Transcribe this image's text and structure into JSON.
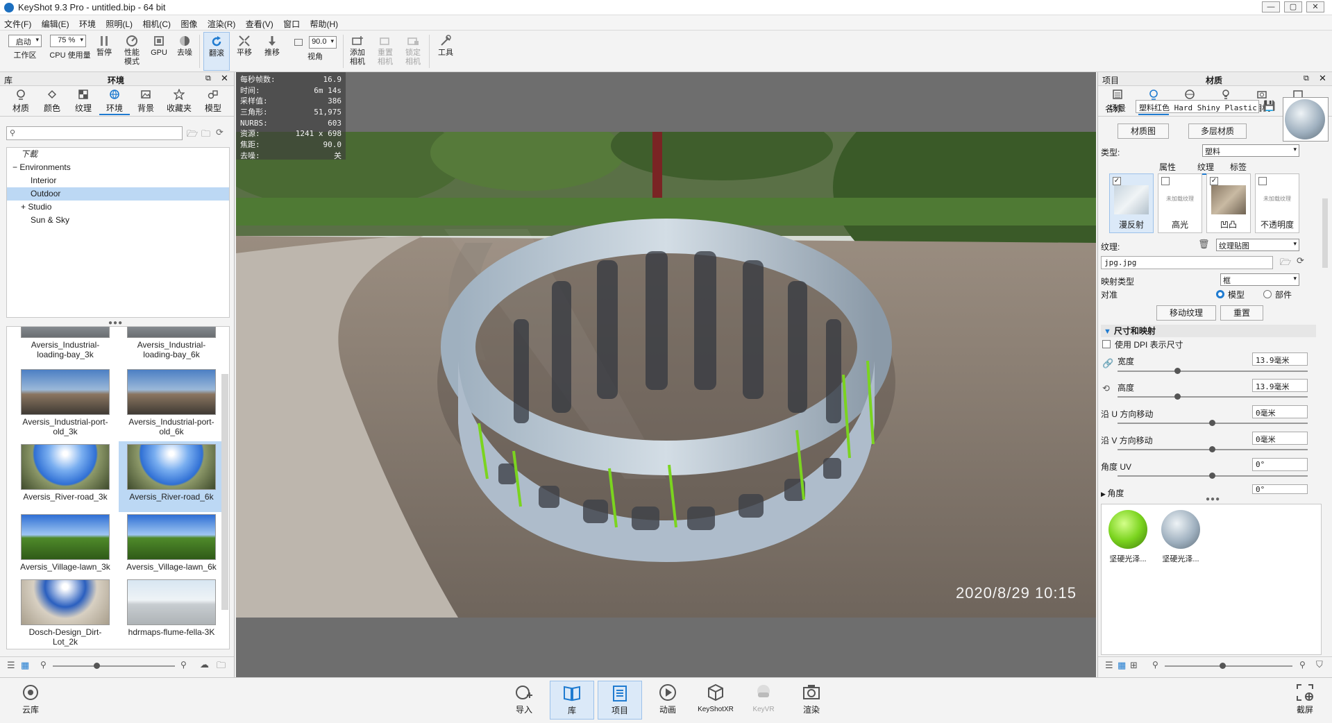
{
  "window": {
    "title": "KeyShot 9.3 Pro  - untitled.bip  - 64 bit",
    "controls": [
      "—",
      "▢",
      "✕"
    ]
  },
  "menu": [
    "文件(F)",
    "编辑(E)",
    "环境",
    "照明(L)",
    "相机(C)",
    "图像",
    "渲染(R)",
    "查看(V)",
    "窗口",
    "帮助(H)"
  ],
  "toolbar": {
    "workspace_value": "启动",
    "workspace_label": "工作区",
    "cpu_value": "75 %",
    "cpu_label": "CPU 使用量",
    "pause": "暂停",
    "perf_line1": "性能",
    "perf_line2": "模式",
    "gpu": "GPU",
    "denoise": "去噪",
    "tumble": "翻滚",
    "pan": "平移",
    "dolly": "推移",
    "fov_value": "90.0",
    "fov_label": "视角",
    "add_cam_1": "添加",
    "add_cam_2": "相机",
    "reset_cam_1": "重置",
    "reset_cam_2": "相机",
    "lock_cam_1": "锁定",
    "lock_cam_2": "相机",
    "tools": "工具"
  },
  "library": {
    "header_left": "库",
    "header_title": "环境",
    "tabs": [
      "材质",
      "颜色",
      "纹理",
      "环境",
      "背景",
      "收藏夹",
      "模型"
    ],
    "tree": {
      "download": "下載",
      "environments": "Environments",
      "interior": "Interior",
      "outdoor": "Outdoor",
      "studio": "Studio",
      "sunsky": "Sun & Sky"
    },
    "thumbs": [
      {
        "n1": "Aversis_Industrial-",
        "n2": "loading-bay_3k"
      },
      {
        "n1": "Aversis_Industrial-",
        "n2": "loading-bay_6k"
      },
      {
        "n1": "Aversis_Industrial-port-",
        "n2": "old_3k"
      },
      {
        "n1": "Aversis_Industrial-port-",
        "n2": "old_6k"
      },
      {
        "n1": "Aversis_River-road_3k",
        "n2": ""
      },
      {
        "n1": "Aversis_River-road_6k",
        "n2": ""
      },
      {
        "n1": "Aversis_Village-lawn_3k",
        "n2": ""
      },
      {
        "n1": "Aversis_Village-lawn_6k",
        "n2": ""
      },
      {
        "n1": "Dosch-Design_Dirt-",
        "n2": "Lot_2k"
      },
      {
        "n1": "hdrmaps-flume-fella-3K",
        "n2": ""
      }
    ]
  },
  "stats": [
    {
      "k": "每秒帧数:",
      "v": "16.9"
    },
    {
      "k": "时间:",
      "v": "6m 14s"
    },
    {
      "k": "采样值:",
      "v": "386"
    },
    {
      "k": "三角形:",
      "v": "51,975"
    },
    {
      "k": "NURBS:",
      "v": "603"
    },
    {
      "k": "资源:",
      "v": "1241 x 698"
    },
    {
      "k": "焦距:",
      "v": "90.0"
    },
    {
      "k": "去噪:",
      "v": "关"
    }
  ],
  "viewport": {
    "timestamp": "2020/8/29  10:15"
  },
  "project": {
    "header_left": "项目",
    "header_title": "材质",
    "tabs": [
      "场景",
      "材质",
      "环境",
      "照明",
      "相机",
      "图像"
    ],
    "name_label": "名称:",
    "name_value": "塑料红色 Hard Shiny Plastic Red",
    "material_graph": "材质图",
    "multilayer": "多层材质",
    "type_label": "类型:",
    "type_value": "塑料",
    "subtabs": [
      "属性",
      "纹理",
      "标签"
    ],
    "cards": [
      {
        "label": "漫反射",
        "checked": "✓",
        "hint": ""
      },
      {
        "label": "高光",
        "checked": "",
        "hint": "未加载纹理"
      },
      {
        "label": "凹凸",
        "checked": "✓",
        "hint": ""
      },
      {
        "label": "不透明度",
        "checked": "",
        "hint": "未加载纹理"
      }
    ],
    "texture_label": "纹理:",
    "texture_type": "纹理贴图",
    "texture_file": "jpg.jpg",
    "mapping_label": "映射类型",
    "mapping_value": "框",
    "align_label": "对准",
    "radio_model": "模型",
    "radio_part": "部件",
    "move_texture": "移动纹理",
    "reset": "重置",
    "section": "尺寸和映射",
    "use_dpi": "使用 DPI 表示尺寸",
    "width_label": "宽度",
    "width_value": "13.9毫米",
    "height_label": "高度",
    "height_value": "13.9毫米",
    "shift_u_label": "沿 U 方向移动",
    "shift_u_value": "0毫米",
    "shift_v_label": "沿 V 方向移动",
    "shift_v_value": "0毫米",
    "angle_uv_label": "角度 UV",
    "angle_uv_value": "0°",
    "angle_label": "角度",
    "angle_value": "0°",
    "swatches": [
      "坚硬光泽...",
      "坚硬光泽..."
    ]
  },
  "dock": [
    "云库",
    "导入",
    "库",
    "项目",
    "动画",
    "KeyShotXR",
    "KeyVR",
    "渲染",
    "截屏"
  ],
  "colors": {
    "accent": "#1f7bd0",
    "selection": "#bcd8f4",
    "green_swatch": "#7bd41f"
  }
}
